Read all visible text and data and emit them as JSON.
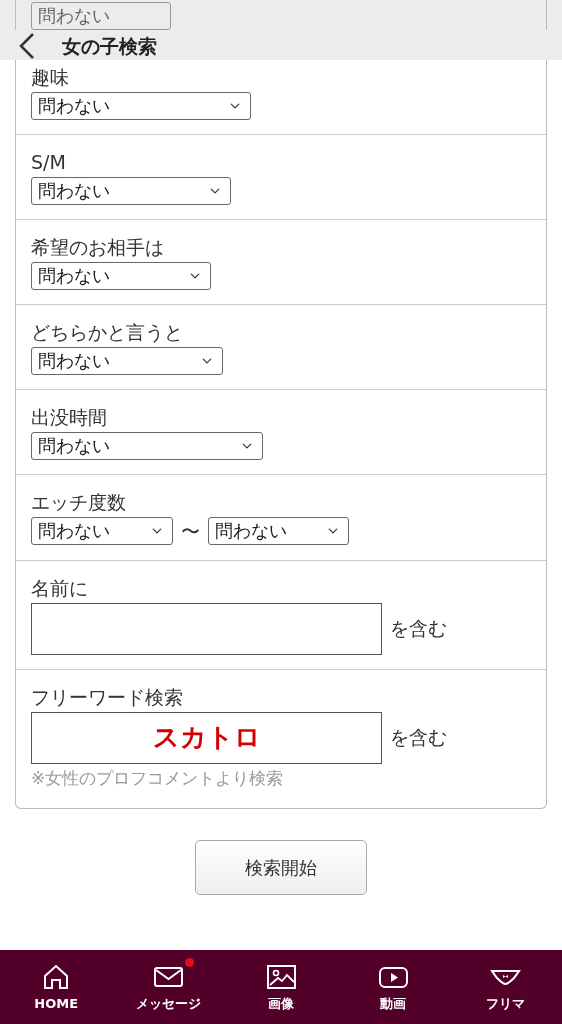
{
  "header": {
    "title": "女の子検索"
  },
  "rows": [
    {
      "kind": "select",
      "fields": [
        {
          "value": "問わない"
        }
      ]
    },
    {
      "kind": "select",
      "label": "趣味",
      "fields": [
        {
          "value": "問わない"
        }
      ]
    },
    {
      "kind": "select",
      "label": "S/M",
      "fields": [
        {
          "value": "問わない"
        }
      ]
    },
    {
      "kind": "select",
      "label": "希望のお相手は",
      "fields": [
        {
          "value": "問わない"
        }
      ]
    },
    {
      "kind": "select",
      "label": "どちらかと言うと",
      "fields": [
        {
          "value": "問わない"
        }
      ]
    },
    {
      "kind": "select",
      "label": "出没時間",
      "fields": [
        {
          "value": "問わない"
        }
      ]
    },
    {
      "kind": "range",
      "label": "エッチ度数",
      "fields": [
        {
          "value": "問わない"
        },
        {
          "value": "問わない"
        }
      ],
      "separator": "〜"
    },
    {
      "kind": "text",
      "label": "名前に",
      "suffix": "を含む"
    },
    {
      "kind": "text",
      "label": "フリーワード検索",
      "value": "スカトロ",
      "suffix": "を含む",
      "note": "※女性のプロフコメントより検索"
    }
  ],
  "submit": "検索開始",
  "nav": [
    {
      "label": "HOME",
      "notification": false
    },
    {
      "label": "メッセージ",
      "notification": true
    },
    {
      "label": "画像",
      "notification": false
    },
    {
      "label": "動画",
      "notification": false
    },
    {
      "label": "フリマ",
      "notification": false
    }
  ]
}
